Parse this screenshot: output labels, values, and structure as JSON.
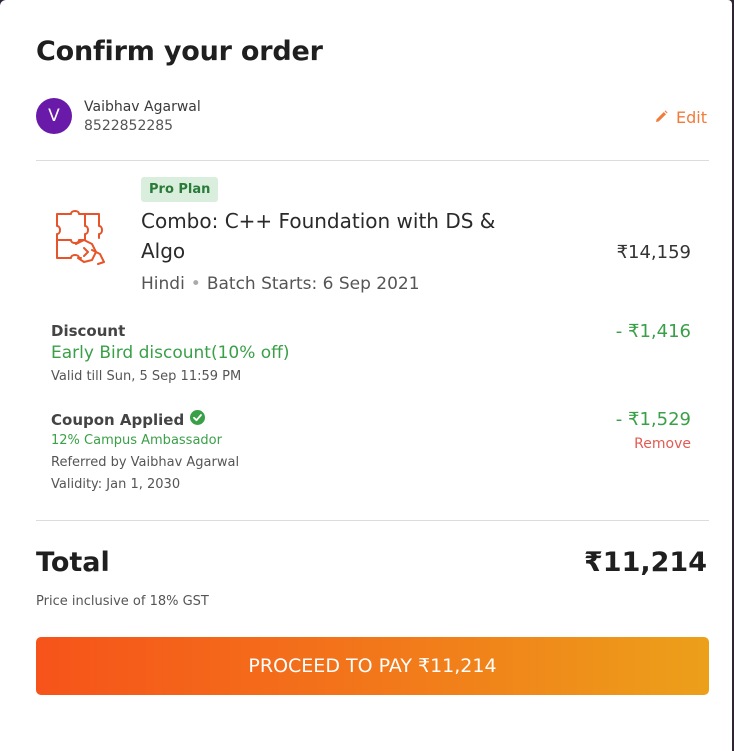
{
  "page": {
    "title": "Confirm your order"
  },
  "user": {
    "initial": "V",
    "name": "Vaibhav Agarwal",
    "phone": "8522852285",
    "edit_label": "Edit"
  },
  "course": {
    "badge": "Pro Plan",
    "title": "Combo: C++ Foundation with DS & Algo",
    "price": "₹14,159",
    "language": "Hindi",
    "batch_label": "Batch Starts:",
    "batch_date": "6 Sep 2021",
    "icon": "puzzle-icon"
  },
  "discount": {
    "label": "Discount",
    "name": "Early Bird discount(10% off)",
    "valid": "Valid till Sun, 5 Sep 11:59 PM",
    "amount": "- ₹1,416"
  },
  "coupon": {
    "label": "Coupon Applied",
    "name": "12% Campus Ambassador",
    "referred": "Referred by Vaibhav Agarwal",
    "validity": "Validity: Jan 1, 2030",
    "amount": "- ₹1,529",
    "remove_label": "Remove"
  },
  "total": {
    "label": "Total",
    "amount": "₹11,214",
    "note": "Price inclusive of 18% GST"
  },
  "pay_button": {
    "label": "PROCEED TO PAY ₹11,214"
  },
  "colors": {
    "accent": "#f07b3a",
    "green": "#3aa048",
    "avatar": "#6a1aa8",
    "remove": "#e35a52",
    "button_start": "#f6531a",
    "button_end": "#eca01a"
  }
}
